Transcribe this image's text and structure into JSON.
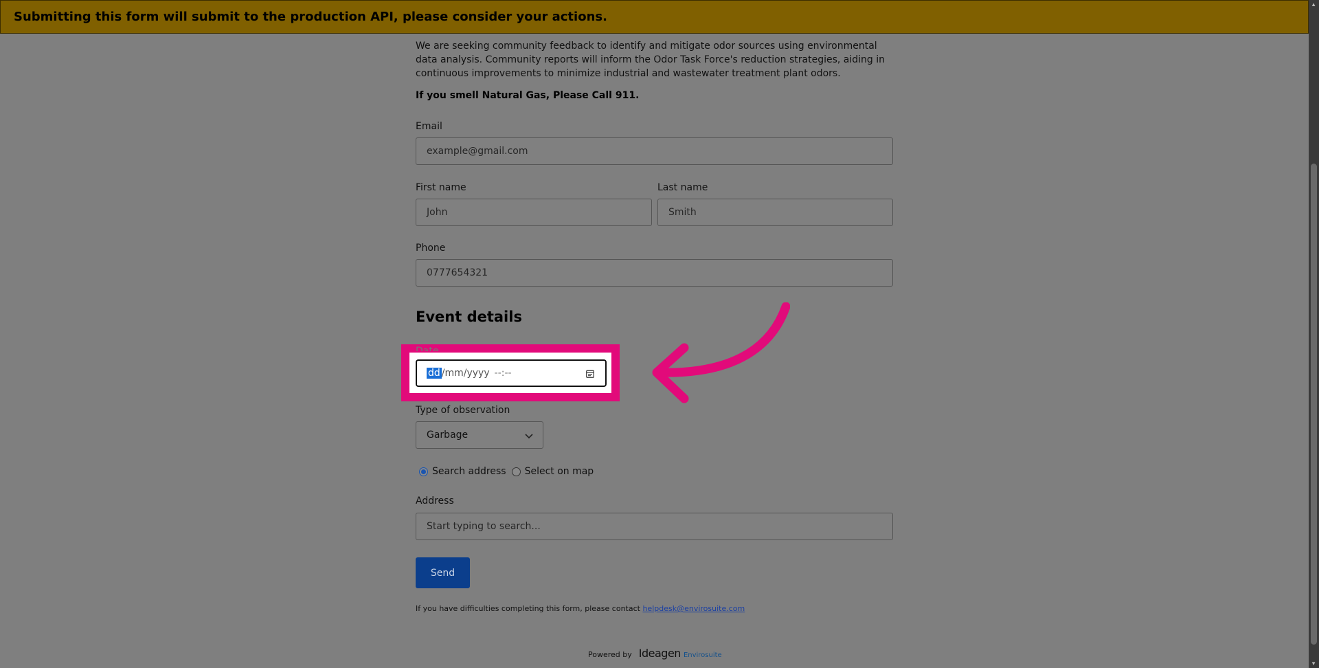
{
  "banner": {
    "text": "Submitting this form will submit to the production API, please consider your actions."
  },
  "intro": {
    "text": "We are seeking community feedback to identify and mitigate odor sources using environmental data analysis. Community reports will inform the Odor Task Force's reduction strategies, aiding in continuous improvements to minimize industrial and wastewater treatment plant odors.",
    "warning": "If you smell Natural Gas, Please Call 911."
  },
  "form": {
    "email": {
      "label": "Email",
      "placeholder": "example@gmail.com"
    },
    "first_name": {
      "label": "First name",
      "placeholder": "John"
    },
    "last_name": {
      "label": "Last name",
      "placeholder": "Smith"
    },
    "phone": {
      "label": "Phone",
      "placeholder": "0777654321"
    },
    "event_section_title": "Event details",
    "date": {
      "label": "Date",
      "segment_day": "dd",
      "segment_rest": "/mm/yyyy",
      "segment_time": "--:--"
    },
    "observation": {
      "label": "Type of observation",
      "selected": "Garbage"
    },
    "location_mode": {
      "options": [
        "Search address",
        "Select on map"
      ],
      "selected": "Search address"
    },
    "address": {
      "label": "Address",
      "placeholder": "Start typing to search..."
    },
    "send_label": "Send"
  },
  "footer": {
    "help_text": "If you have difficulties completing this form, please contact ",
    "help_email": "helpdesk@envirosuite.com",
    "powered_by": "Powered by",
    "logo_main": "Ideagen",
    "logo_sub": "Envirosuite"
  },
  "colors": {
    "banner_bg": "#806000",
    "highlight_frame": "#e20a7a",
    "send_button": "#0b3e8c",
    "selection": "#1a6fd6"
  },
  "icons": [
    "calendar-icon",
    "chevron-down-icon",
    "annotation-arrow-icon",
    "scroll-up-icon",
    "scroll-down-icon"
  ]
}
